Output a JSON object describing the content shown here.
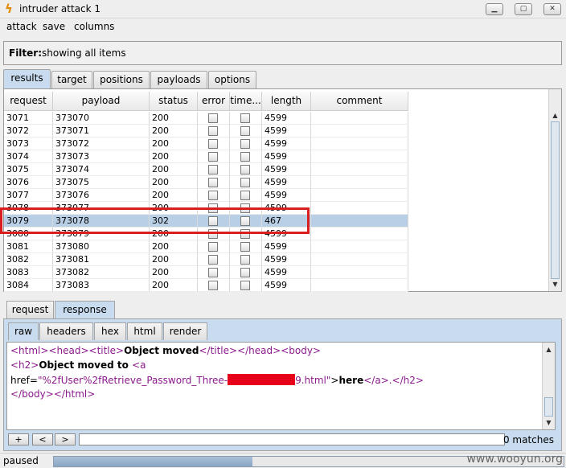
{
  "window": {
    "title": "intruder attack 1",
    "icon": "lightning-icon"
  },
  "menu": [
    "attack",
    "save",
    "columns"
  ],
  "filter": {
    "label": "Filter:",
    "value": "showing all items"
  },
  "tabs": [
    "results",
    "target",
    "positions",
    "payloads",
    "options"
  ],
  "table": {
    "columns": [
      "request",
      "payload",
      "status",
      "error",
      "time...",
      "length",
      "comment"
    ],
    "rows": [
      {
        "request": "3071",
        "payload": "373070",
        "status": "200",
        "length": "4599"
      },
      {
        "request": "3072",
        "payload": "373071",
        "status": "200",
        "length": "4599"
      },
      {
        "request": "3073",
        "payload": "373072",
        "status": "200",
        "length": "4599"
      },
      {
        "request": "3074",
        "payload": "373073",
        "status": "200",
        "length": "4599"
      },
      {
        "request": "3075",
        "payload": "373074",
        "status": "200",
        "length": "4599"
      },
      {
        "request": "3076",
        "payload": "373075",
        "status": "200",
        "length": "4599"
      },
      {
        "request": "3077",
        "payload": "373076",
        "status": "200",
        "length": "4599"
      },
      {
        "request": "3078",
        "payload": "373077",
        "status": "200",
        "length": "4599"
      },
      {
        "request": "3079",
        "payload": "373078",
        "status": "302",
        "length": "467",
        "selected": true
      },
      {
        "request": "3080",
        "payload": "373079",
        "status": "200",
        "length": "4599"
      },
      {
        "request": "3081",
        "payload": "373080",
        "status": "200",
        "length": "4599"
      },
      {
        "request": "3082",
        "payload": "373081",
        "status": "200",
        "length": "4599"
      },
      {
        "request": "3083",
        "payload": "373082",
        "status": "200",
        "length": "4599"
      },
      {
        "request": "3084",
        "payload": "373083",
        "status": "200",
        "length": "4599"
      }
    ]
  },
  "detail_tabs": [
    "request",
    "response"
  ],
  "view_tabs": [
    "raw",
    "headers",
    "hex",
    "html",
    "render"
  ],
  "response_body": {
    "l1_open": "<html><head><title>",
    "l1_title": "Object moved",
    "l1_close": "</title></head><body>",
    "l2_open": "<h2>",
    "l2_text": "Object moved to ",
    "l2_a": "<a",
    "l3_attr": "href=",
    "l3_val_a": "\"%2fUser%2fRetrieve_Password_Three-",
    "l3_val_b": "9.html\"",
    "l3_gt": ">",
    "l3_here": "here",
    "l3_close": "</a>.</h2>",
    "l4": "</body></html>"
  },
  "search": {
    "buttons": [
      "+",
      "<",
      ">"
    ],
    "matches": "0 matches"
  },
  "status": {
    "text": "paused",
    "progress": 0.39
  },
  "watermark": "www.wooyun.org"
}
